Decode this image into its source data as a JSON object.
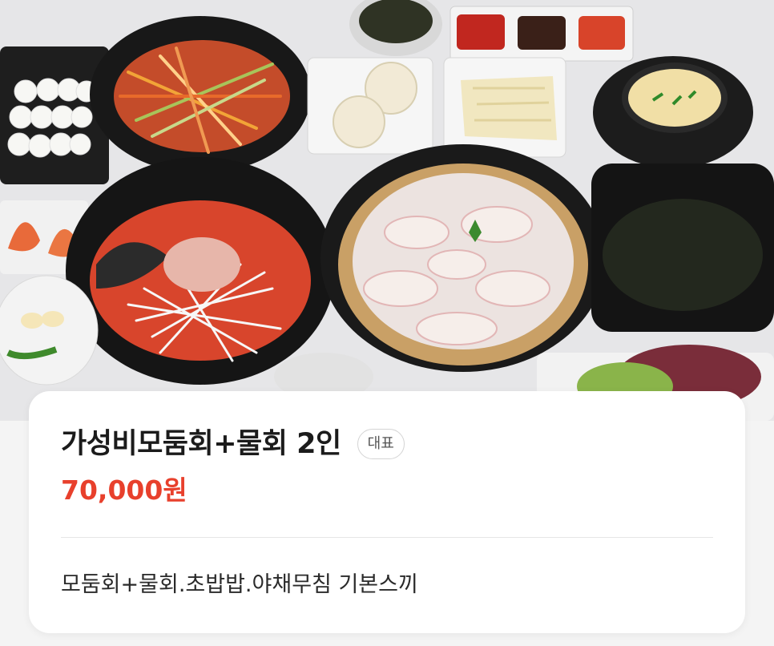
{
  "menu_item": {
    "name": "가성비모둠회+물회 2인",
    "badge": "대표",
    "price": "70,000원",
    "description": "모둠회+물회.초밥밥.야채무침 기본스끼"
  },
  "photo": {
    "icon": "food-photo",
    "dishes": [
      "sushi-rice-plate",
      "vegetable-salad-bowl",
      "seaweed-broth-bowl",
      "sauce-tray",
      "noodle-plate",
      "pickled-radish-plate",
      "steamed-egg-pot",
      "shrimp-plate",
      "mulhoe-spicy-bowl",
      "sashimi-platter",
      "seaweed-soup-bowl",
      "garlic-pepper-plate",
      "lettuce-plate"
    ]
  },
  "colors": {
    "price": "#e8402c",
    "title": "#1b1b1b",
    "card": "#ffffff",
    "background": "#f4f4f4"
  }
}
